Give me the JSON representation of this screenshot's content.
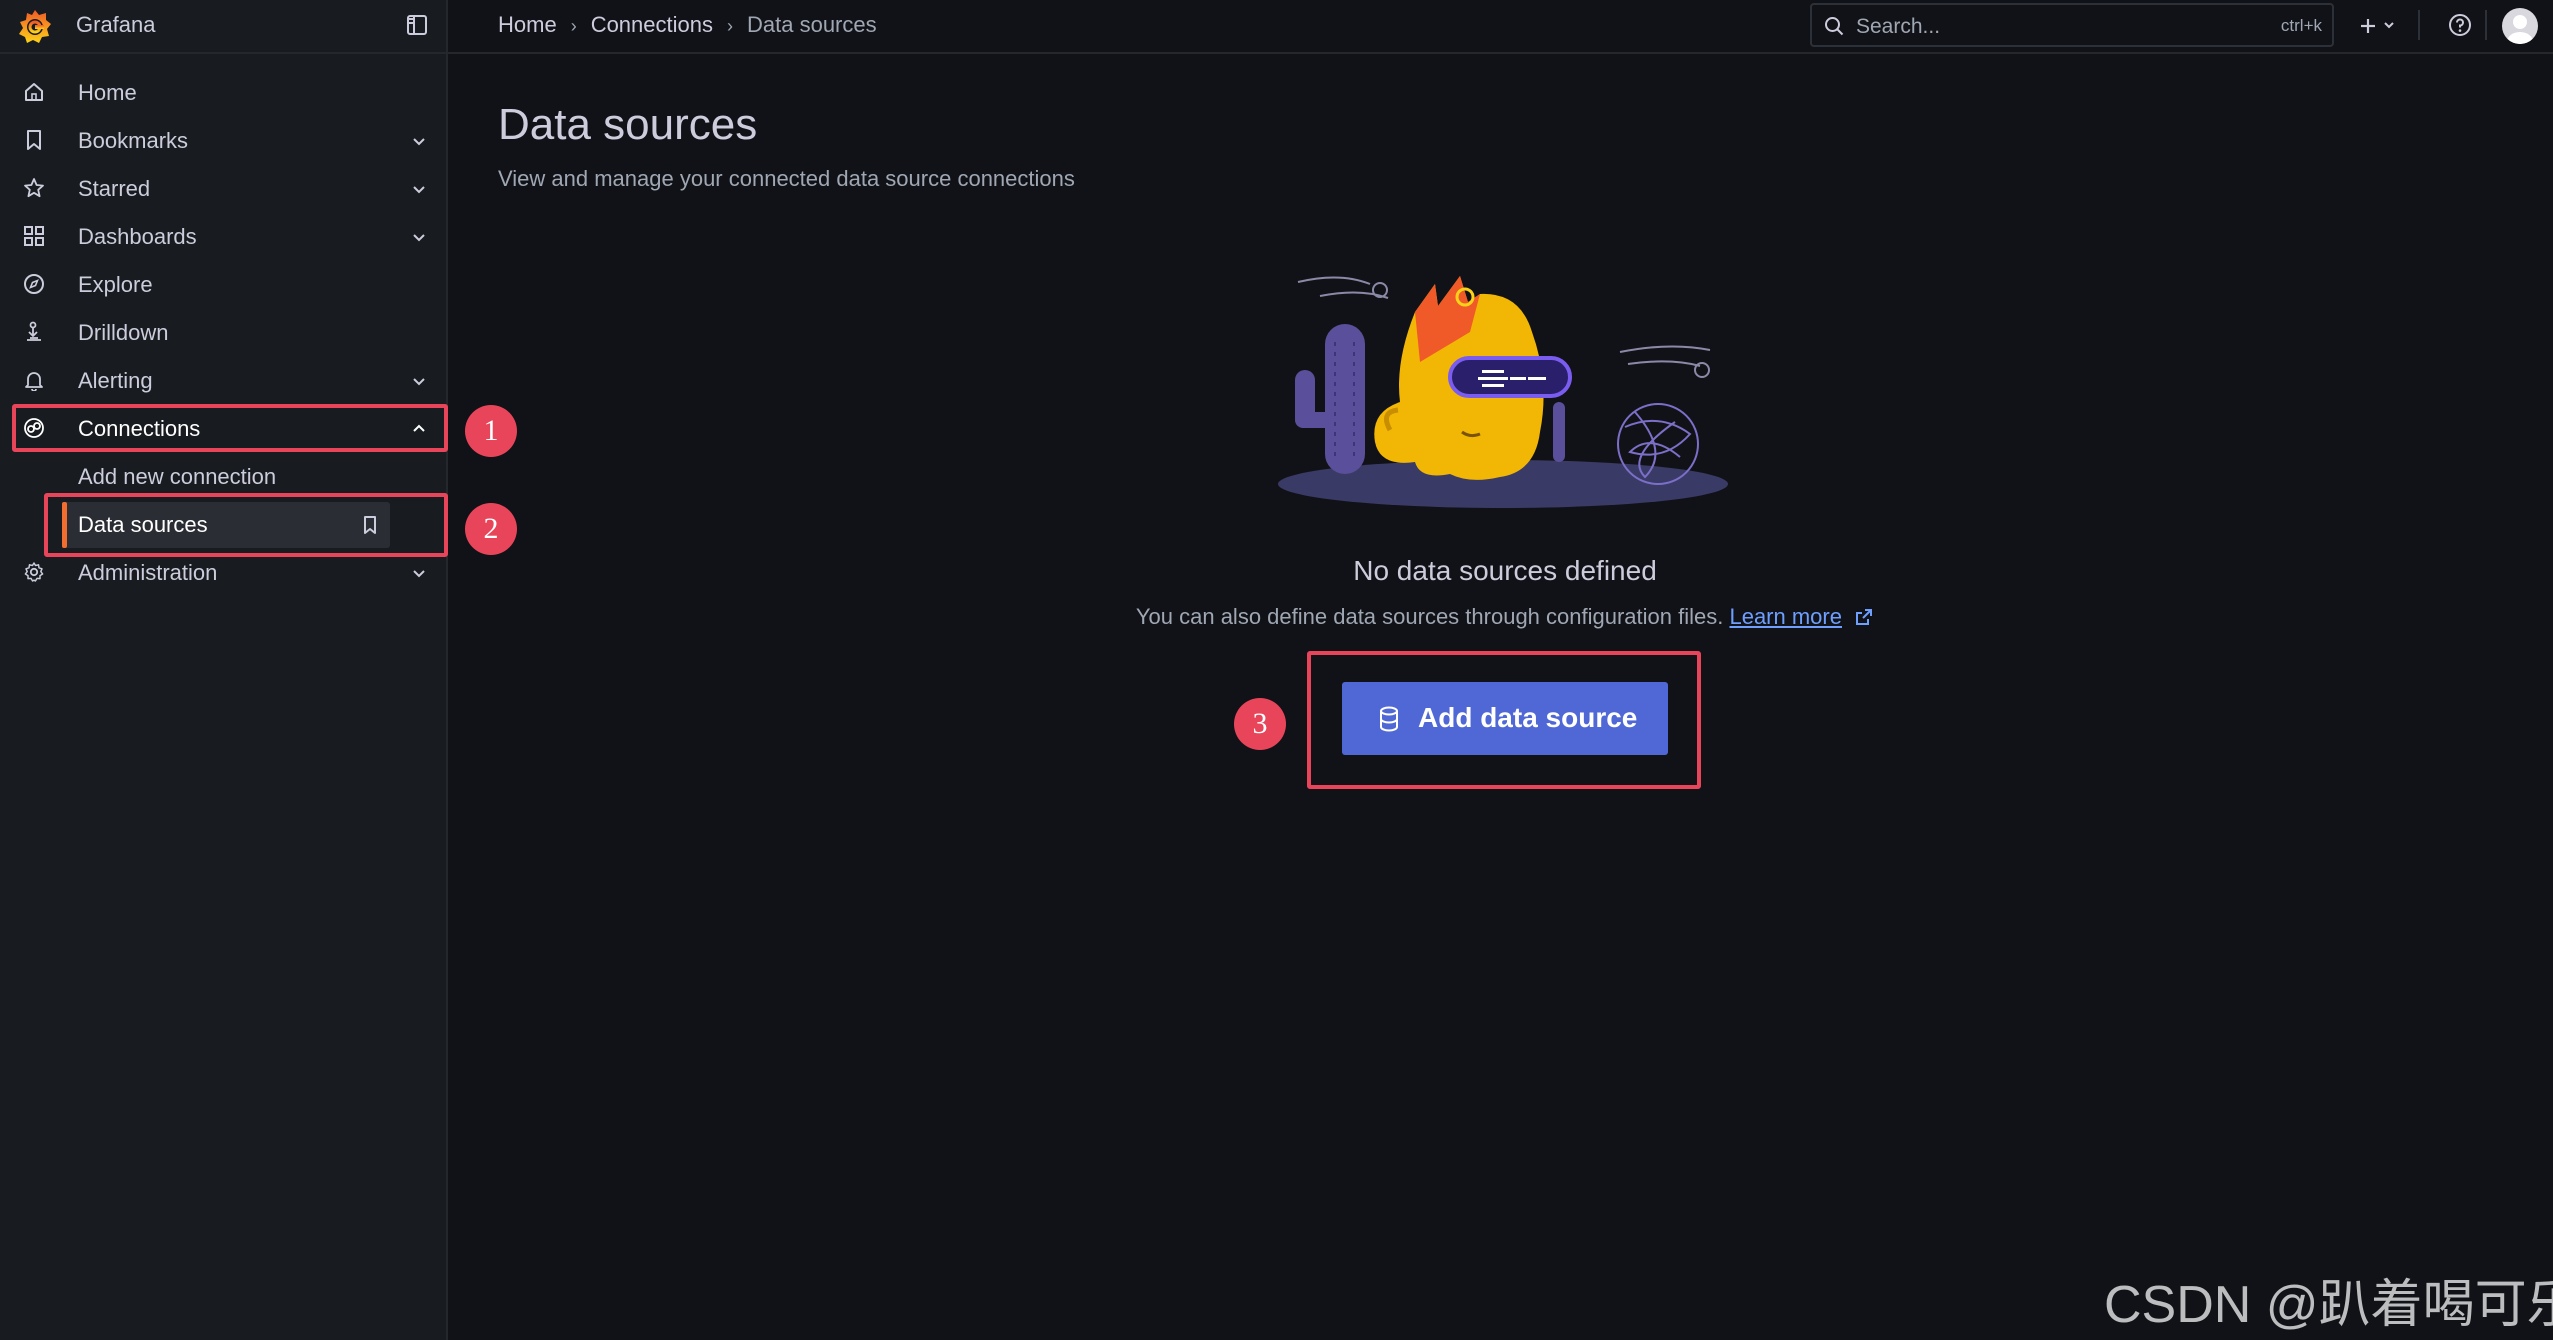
{
  "app": {
    "name": "Grafana"
  },
  "breadcrumbs": [
    "Home",
    "Connections",
    "Data sources"
  ],
  "search": {
    "placeholder": "Search...",
    "shortcut": "ctrl+k"
  },
  "sidebar": {
    "items": [
      {
        "label": "Home",
        "icon": "home-icon"
      },
      {
        "label": "Bookmarks",
        "icon": "bookmark-icon",
        "expandable": true
      },
      {
        "label": "Starred",
        "icon": "star-icon",
        "expandable": true
      },
      {
        "label": "Dashboards",
        "icon": "apps-icon",
        "expandable": true
      },
      {
        "label": "Explore",
        "icon": "compass-icon"
      },
      {
        "label": "Drilldown",
        "icon": "drilldown-icon"
      },
      {
        "label": "Alerting",
        "icon": "bell-icon",
        "expandable": true
      },
      {
        "label": "Connections",
        "icon": "connections-icon",
        "expanded": true,
        "children": [
          {
            "label": "Add new connection"
          },
          {
            "label": "Data sources",
            "selected": true
          }
        ]
      },
      {
        "label": "Administration",
        "icon": "cog-icon",
        "expandable": true
      }
    ]
  },
  "page": {
    "title": "Data sources",
    "subtitle": "View and manage your connected data source connections"
  },
  "empty_state": {
    "title": "No data sources defined",
    "description": "You can also define data sources through configuration files.",
    "link": "Learn more",
    "button": "Add data source"
  },
  "annotations": [
    "1",
    "2",
    "3"
  ],
  "watermark": "CSDN @趴着喝可乐",
  "colors": {
    "accent": "#f16d30",
    "primary_button": "#5068d6",
    "highlight": "#e8455a",
    "link": "#6e9fff"
  }
}
